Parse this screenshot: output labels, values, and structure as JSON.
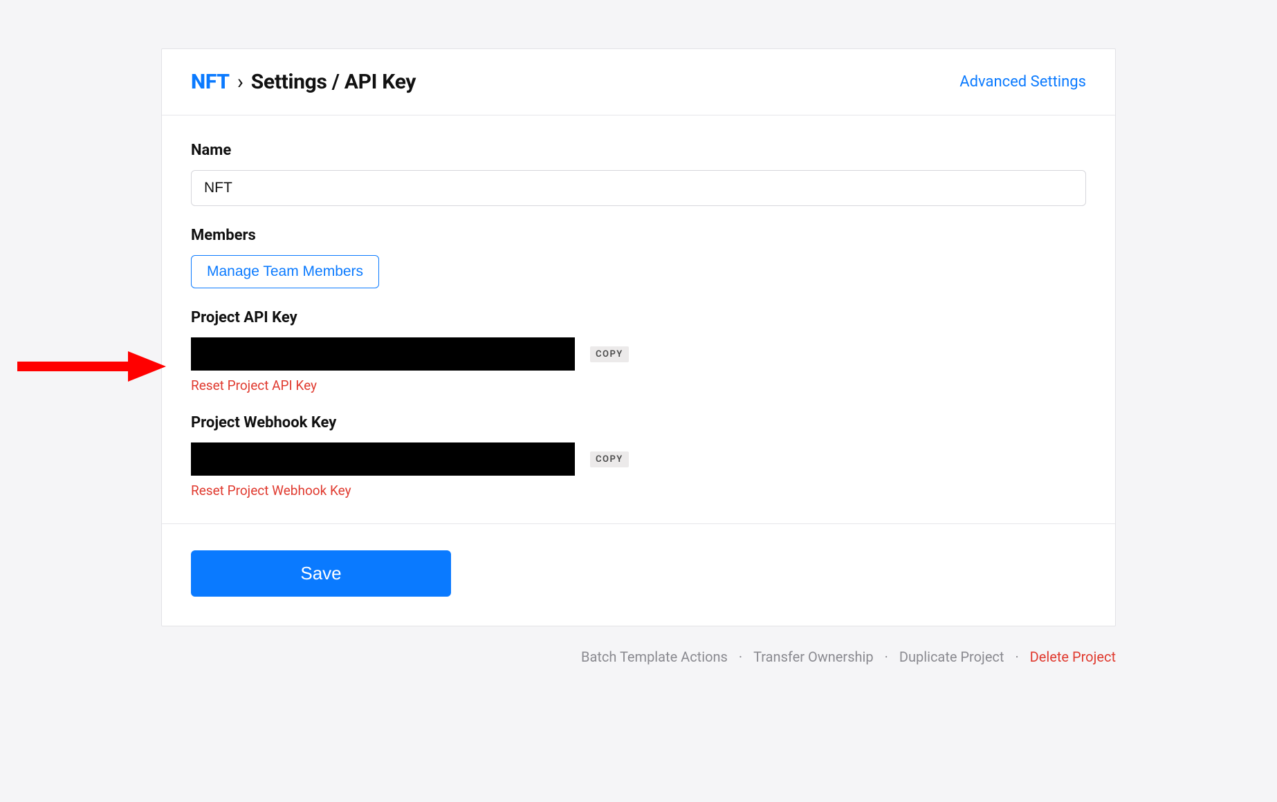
{
  "colors": {
    "primary": "#0a7aff",
    "danger": "#e03a2f",
    "muted": "#8a8a90"
  },
  "header": {
    "project_name": "NFT",
    "separator": "›",
    "page_title": "Settings / API Key",
    "advanced_link": "Advanced Settings"
  },
  "form": {
    "name_label": "Name",
    "name_value": "NFT",
    "members_label": "Members",
    "manage_members_btn": "Manage Team Members",
    "api_key_label": "Project API Key",
    "api_key_value": "",
    "api_key_copy": "COPY",
    "api_key_reset": "Reset Project API Key",
    "webhook_key_label": "Project Webhook Key",
    "webhook_key_value": "",
    "webhook_key_copy": "COPY",
    "webhook_key_reset": "Reset Project Webhook Key"
  },
  "actions": {
    "save": "Save"
  },
  "footer": {
    "batch": "Batch Template Actions",
    "transfer": "Transfer Ownership",
    "duplicate": "Duplicate Project",
    "delete": "Delete Project"
  }
}
